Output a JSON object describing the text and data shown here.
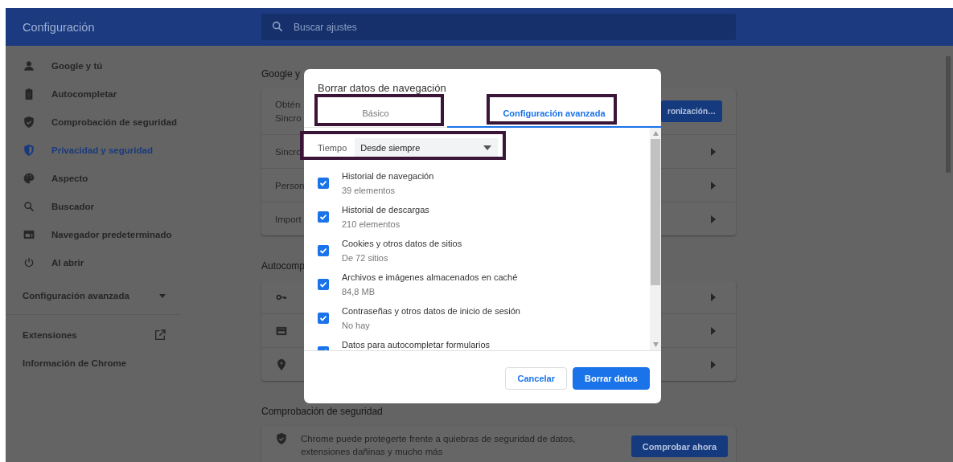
{
  "header": {
    "title": "Configuración",
    "search": {
      "placeholder": "Buscar ajustes"
    }
  },
  "sidebar": {
    "items": [
      {
        "label": "Google y tú",
        "selected": false
      },
      {
        "label": "Autocompletar",
        "selected": false
      },
      {
        "label": "Comprobación de seguridad",
        "selected": false
      },
      {
        "label": "Privacidad y seguridad",
        "selected": true
      },
      {
        "label": "Aspecto",
        "selected": false
      },
      {
        "label": "Buscador",
        "selected": false
      },
      {
        "label": "Navegador predeterminado",
        "selected": false
      },
      {
        "label": "Al abrir",
        "selected": false
      }
    ],
    "advanced": {
      "label": "Configuración avanzada",
      "expanded": false
    },
    "links": [
      {
        "label": "Extensiones",
        "external": true
      },
      {
        "label": "Información de Chrome",
        "external": false
      }
    ]
  },
  "sections": [
    {
      "title": "Google y",
      "rows": [
        {
          "kind": "sync",
          "title": "Obtén",
          "subtitle": "Sincro",
          "button": "ronización…"
        },
        {
          "kind": "link",
          "title": "Sincro"
        },
        {
          "kind": "link",
          "title": "Person"
        },
        {
          "kind": "link",
          "title": "Import"
        }
      ]
    },
    {
      "title": "Autocomp",
      "rows": [
        {
          "kind": "icon"
        },
        {
          "kind": "icon"
        },
        {
          "kind": "icon"
        }
      ]
    },
    {
      "title": "Comprobación de seguridad",
      "rows": [
        {
          "kind": "check",
          "text": "Chrome puede protegerte frente a quiebras de seguridad de datos, extensiones dañinas y mucho más",
          "button": "Comprobar ahora"
        }
      ]
    }
  ],
  "dialog": {
    "title": "Borrar datos de navegación",
    "tabs": [
      {
        "label": "Básico",
        "selected": false
      },
      {
        "label": "Configuración avanzada",
        "selected": true
      }
    ],
    "time": {
      "label": "Tiempo",
      "value": "Desde siempre"
    },
    "items": [
      {
        "title": "Historial de navegación",
        "subtitle": "39 elementos",
        "checked": true
      },
      {
        "title": "Historial de descargas",
        "subtitle": "210 elementos",
        "checked": true
      },
      {
        "title": "Cookies y otros datos de sitios",
        "subtitle": "De 72 sitios",
        "checked": true
      },
      {
        "title": "Archivos e imágenes almacenados en caché",
        "subtitle": "84,8 MB",
        "checked": true
      },
      {
        "title": "Contraseñas y otros datos de inicio de sesión",
        "subtitle": "No hay",
        "checked": true
      },
      {
        "title": "Datos para autocompletar formularios",
        "checked": true
      }
    ],
    "buttons": [
      {
        "label": "Cancelar",
        "kind": "secondary"
      },
      {
        "label": "Borrar datos",
        "kind": "primary"
      }
    ]
  }
}
